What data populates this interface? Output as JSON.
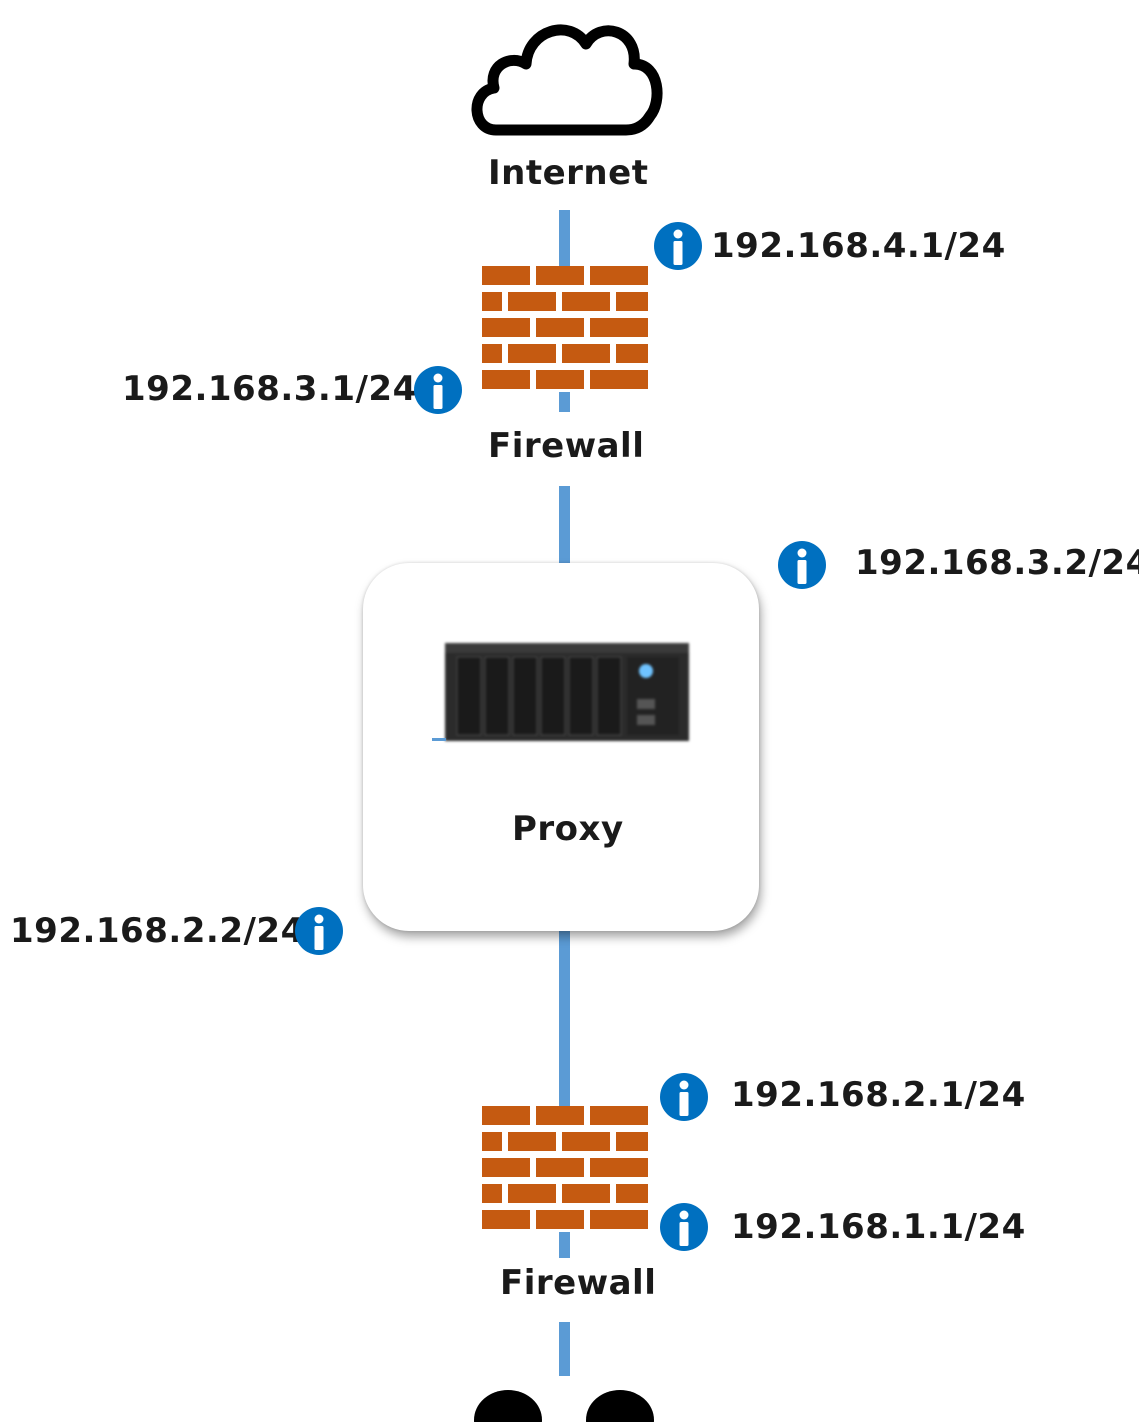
{
  "nodes": {
    "internet": {
      "label": "Internet",
      "icon": "cloud-icon"
    },
    "firewall_top": {
      "label": "Firewall",
      "icon": "firewall-icon"
    },
    "proxy": {
      "label": "Proxy",
      "icon": "server-icon"
    },
    "firewall_bottom": {
      "label": "Firewall",
      "icon": "firewall-icon"
    }
  },
  "interfaces": {
    "fw_top_outer": "192.168.4.1/24",
    "fw_top_inner": "192.168.3.1/24",
    "proxy_outer": "192.168.3.2/24",
    "proxy_inner": "192.168.2.2/24",
    "fw_bottom_outer": "192.168.2.1/24",
    "fw_bottom_inner": "192.168.1.1/24"
  },
  "colors": {
    "link": "#5b9bd5",
    "brick": "#c55a11",
    "mortar": "#ffffff",
    "info": "#0070c0"
  }
}
